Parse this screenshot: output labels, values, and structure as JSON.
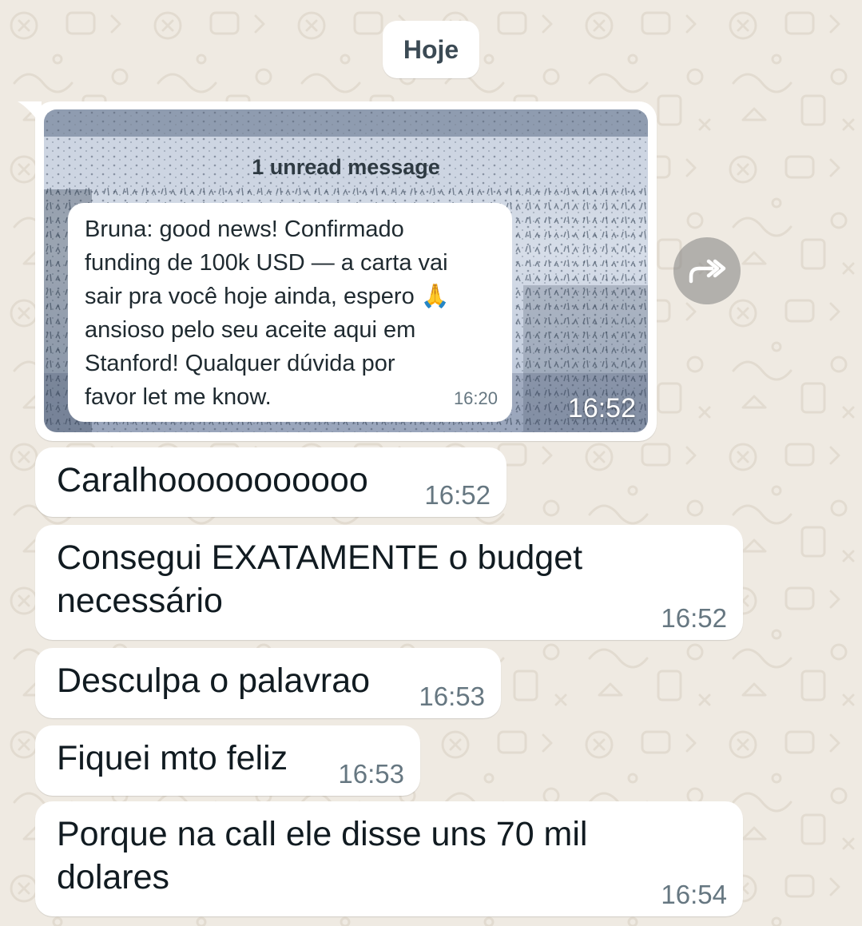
{
  "chat": {
    "date_separator": "Hoje",
    "image_message": {
      "unread_banner": "1 unread message",
      "quoted": {
        "text": "Bruna: good news! Confirmado\nfunding de 100k USD — a carta vai\nsair pra você hoje ainda, espero 🙏\nansioso pelo seu aceite aqui em\nStanford! Qualquer dúvida por\nfavor let me know.",
        "time": "16:20"
      },
      "time": "16:52"
    },
    "forward_icon": "forward-icon",
    "messages": [
      {
        "text": "Caralhooooooooooo",
        "time": "16:52"
      },
      {
        "text": "Consegui EXATAMENTE o budget\nnecessário",
        "time": "16:52"
      },
      {
        "text": "Desculpa o palavrao",
        "time": "16:53"
      },
      {
        "text": "Fiquei mto feliz",
        "time": "16:53"
      },
      {
        "text": "Porque na call ele disse uns 70 mil\ndolares",
        "time": "16:54"
      }
    ]
  },
  "colors": {
    "wallpaper": "#efeae2",
    "bubble": "#ffffff",
    "timestamp": "#667781"
  }
}
